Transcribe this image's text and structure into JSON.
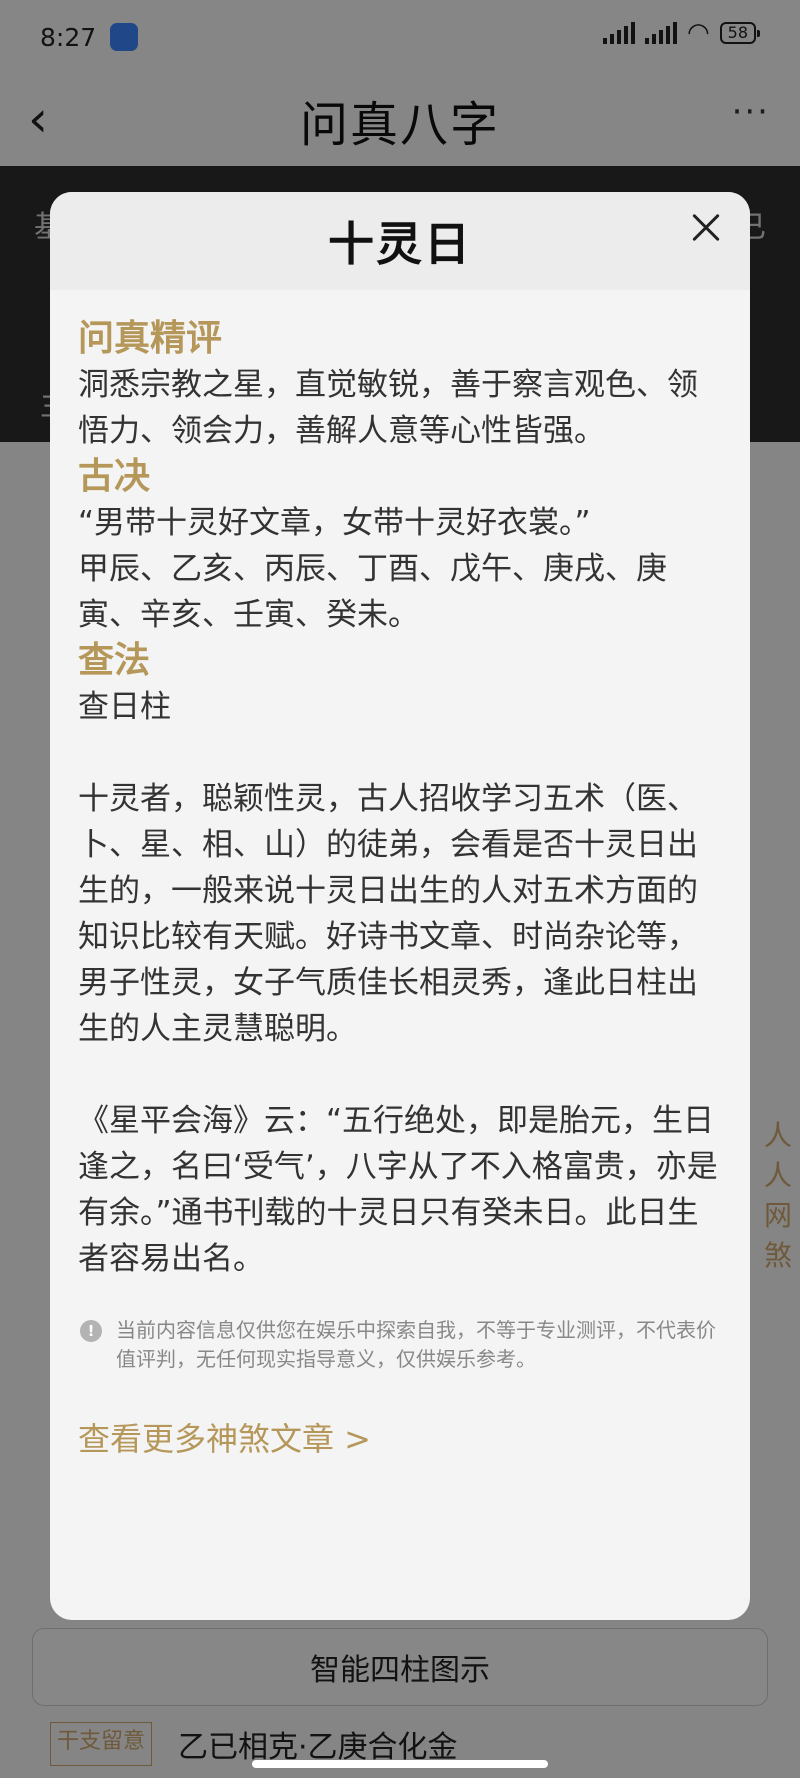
{
  "status_bar": {
    "time": "8:27",
    "battery": "58"
  },
  "nav": {
    "back": "‹",
    "title": "问真八字",
    "more": "···"
  },
  "background": {
    "peek_left": "基",
    "peek_right": "已",
    "peek_left2": "主",
    "side_peek": [
      "人",
      "人",
      "网",
      "煞"
    ],
    "bottom_button": "智能四柱图示",
    "bottom_tag": "干支留意",
    "bottom_text": "乙已相克·乙庚合化金"
  },
  "modal": {
    "title": "十灵日",
    "sections": [
      {
        "heading": "问真精评",
        "paragraphs": [
          "洞悉宗教之星，直觉敏锐，善于察言观色、领悟力、领会力，善解人意等心性皆强。"
        ]
      },
      {
        "heading": "古决",
        "paragraphs": [
          "“男带十灵好文章，女带十灵好衣裳。”",
          "甲辰、乙亥、丙辰、丁酉、戊午、庚戌、庚寅、辛亥、壬寅、癸未。"
        ]
      },
      {
        "heading": "查法",
        "paragraphs": [
          "查日柱"
        ]
      }
    ],
    "body": [
      "十灵者，聪颖性灵，古人招收学习五术（医、卜、星、相、山）的徒弟，会看是否十灵日出生的，一般来说十灵日出生的人对五术方面的知识比较有天赋。好诗书文章、时尚杂论等，男子性灵，女子气质佳长相灵秀，逢此日柱出生的人主灵慧聪明。",
      "《星平会海》云：“五行绝处，即是胎元，生日逢之，名曰‘受气’，八字从了不入格富贵，亦是有余。”通书刊载的十灵日只有癸未日。此日生者容易出名。"
    ],
    "disclaimer": "当前内容信息仅供您在娱乐中探索自我，不等于专业测评，不代表价值评判，无任何现实指导意义，仅供娱乐参考。",
    "more_link": "查看更多神煞文章 >"
  },
  "colors": {
    "accent": "#b5975a",
    "overlay": "rgba(0,0,0,0.45)"
  }
}
